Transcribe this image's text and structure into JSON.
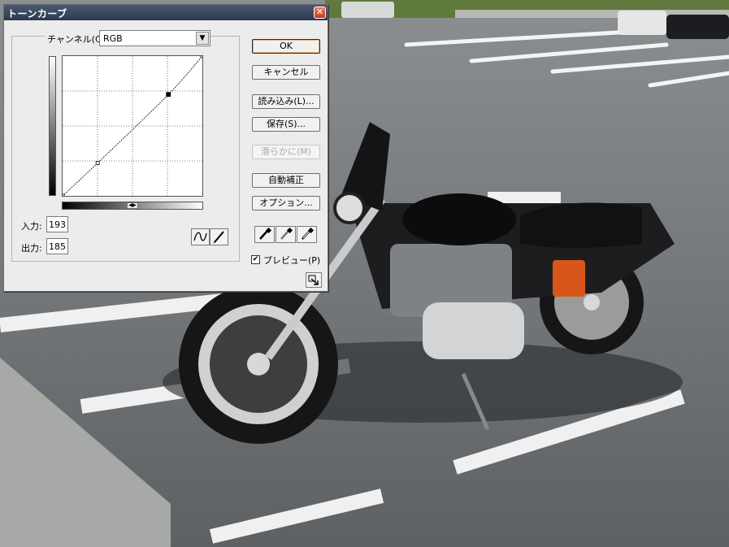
{
  "dialog": {
    "title": "トーンカーブ",
    "close_glyph": "✕",
    "channel_label": "チャンネル(C):",
    "channel_value": "RGB",
    "channel_arrow": "▼",
    "input_label": "入力:",
    "input_value": "193",
    "output_label": "出力:",
    "output_value": "185",
    "gradient_toggle": "◀▶",
    "buttons": {
      "ok": "OK",
      "cancel": "キャンセル",
      "load": "読み込み(L)...",
      "save": "保存(S)...",
      "smooth": "滑らかに(M)",
      "auto": "自動補正",
      "options": "オプション..."
    },
    "preview_label": "プレビュー(P)",
    "preview_checked": true,
    "preview_check_glyph": "✔",
    "tools": [
      "curve-tool-icon",
      "pencil-icon"
    ],
    "droppers": [
      "black-point-eyedropper-icon",
      "gray-point-eyedropper-icon",
      "white-point-eyedropper-icon"
    ]
  },
  "curve": {
    "points": [
      [
        0,
        0
      ],
      [
        64,
        60
      ],
      [
        193,
        185
      ],
      [
        255,
        255
      ]
    ],
    "range": [
      0,
      255
    ],
    "grid_divisions": 4
  },
  "colors": {
    "title_bar": "#2b3a4f",
    "dialog_bg": "#ececec",
    "default_button_glow": "#e7b07a",
    "close_button": "#c43a1e"
  }
}
